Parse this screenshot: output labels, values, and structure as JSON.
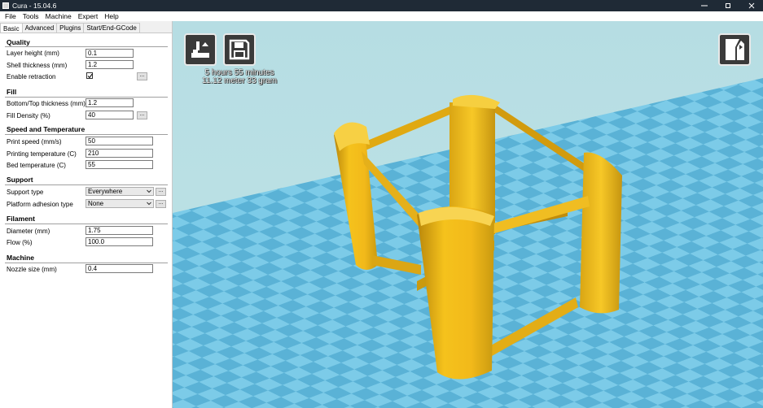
{
  "window": {
    "title": "Cura - 15.04.6"
  },
  "menu": [
    "File",
    "Tools",
    "Machine",
    "Expert",
    "Help"
  ],
  "tabs": [
    "Basic",
    "Advanced",
    "Plugins",
    "Start/End-GCode"
  ],
  "sections": {
    "quality": {
      "title": "Quality",
      "layer_height": {
        "label": "Layer height (mm)",
        "value": "0.1"
      },
      "shell_thickness": {
        "label": "Shell thickness (mm)",
        "value": "1.2"
      },
      "enable_retraction": {
        "label": "Enable retraction",
        "checked": true
      }
    },
    "fill": {
      "title": "Fill",
      "bottom_top_thickness": {
        "label": "Bottom/Top thickness (mm)",
        "value": "1.2"
      },
      "fill_density": {
        "label": "Fill Density (%)",
        "value": "40"
      }
    },
    "speed": {
      "title": "Speed and Temperature",
      "print_speed": {
        "label": "Print speed (mm/s)",
        "value": "50"
      },
      "printing_temperature": {
        "label": "Printing temperature (C)",
        "value": "210"
      },
      "bed_temperature": {
        "label": "Bed temperature (C)",
        "value": "55"
      }
    },
    "support": {
      "title": "Support",
      "support_type": {
        "label": "Support type",
        "value": "Everywhere"
      },
      "platform_adhesion": {
        "label": "Platform adhesion type",
        "value": "None"
      }
    },
    "filament": {
      "title": "Filament",
      "diameter": {
        "label": "Diameter (mm)",
        "value": "1.75"
      },
      "flow": {
        "label": "Flow (%)",
        "value": "100.0"
      }
    },
    "machine": {
      "title": "Machine",
      "nozzle_size": {
        "label": "Nozzle size (mm)",
        "value": "0.4"
      }
    }
  },
  "more_button": "...",
  "viewport": {
    "print_time": "5 hours 55 minutes",
    "print_material": "11.12 meter 33 gram",
    "icons": [
      "load-model-icon",
      "save-toolpath-icon",
      "view-mode-icon"
    ],
    "colors": {
      "model": "#f2b91a",
      "bed_light": "#7ccbe8",
      "bed_dark": "#5ab2d6",
      "sky": "#b6dde3"
    }
  }
}
